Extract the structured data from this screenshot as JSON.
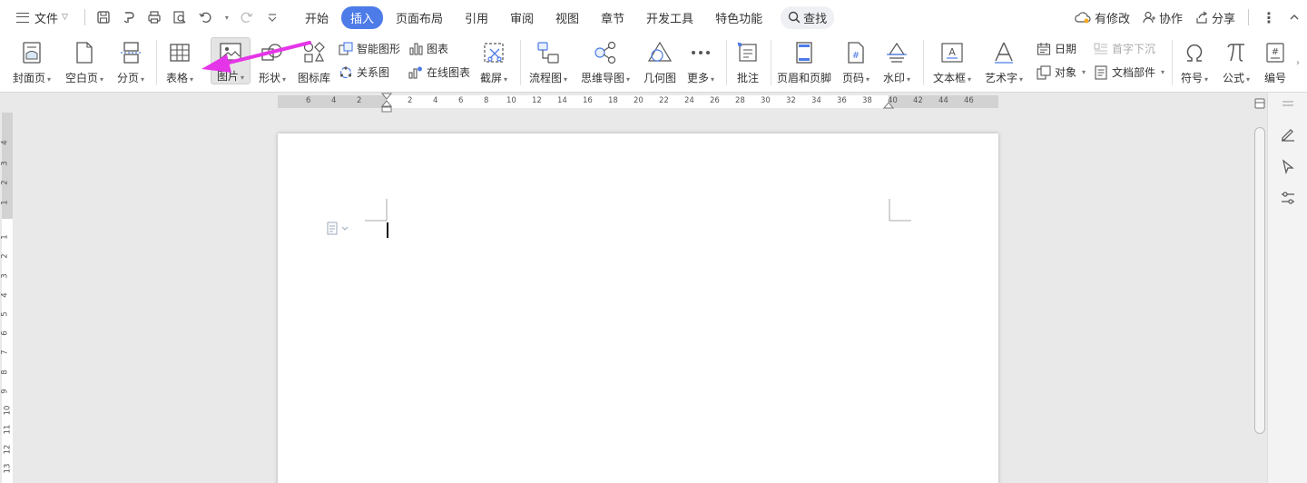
{
  "menubar": {
    "file_label": "文件",
    "tabs": [
      "开始",
      "插入",
      "页面布局",
      "引用",
      "审阅",
      "视图",
      "章节",
      "开发工具",
      "特色功能"
    ],
    "active_tab": "插入",
    "search_label": "查找",
    "modified_label": "有修改",
    "collab_label": "协作",
    "share_label": "分享"
  },
  "ribbon": {
    "cover": "封面页",
    "blank": "空白页",
    "pagebreak": "分页",
    "table": "表格",
    "picture": "图片",
    "shape": "形状",
    "iconlib": "图标库",
    "smartart": "智能图形",
    "chart": "图表",
    "relation": "关系图",
    "online_chart": "在线图表",
    "screenshot": "截屏",
    "flowchart": "流程图",
    "mindmap": "思维导图",
    "geometry": "几何图",
    "more": "更多",
    "comment": "批注",
    "header_footer": "页眉和页脚",
    "page_number": "页码",
    "watermark": "水印",
    "textbox": "文本框",
    "wordart": "艺术字",
    "date": "日期",
    "dropcap": "首字下沉",
    "object": "对象",
    "docpart": "文档部件",
    "symbol": "符号",
    "formula": "公式",
    "numbering": "编号"
  },
  "ruler": {
    "h_numbers": [
      "6",
      "4",
      "2",
      "2",
      "4",
      "6",
      "8",
      "10",
      "12",
      "14",
      "16",
      "18",
      "20",
      "22",
      "24",
      "26",
      "28",
      "30",
      "32",
      "34",
      "36",
      "38",
      "40",
      "42",
      "44",
      "46"
    ],
    "v_numbers_top": [
      "4",
      "3",
      "2",
      "1"
    ],
    "v_numbers": [
      "1",
      "2",
      "3",
      "4",
      "5",
      "6",
      "7",
      "8",
      "9",
      "10",
      "11",
      "12",
      "13"
    ]
  },
  "colors": {
    "accent": "#4d7ce8",
    "annotation_arrow": "#e535e8"
  }
}
